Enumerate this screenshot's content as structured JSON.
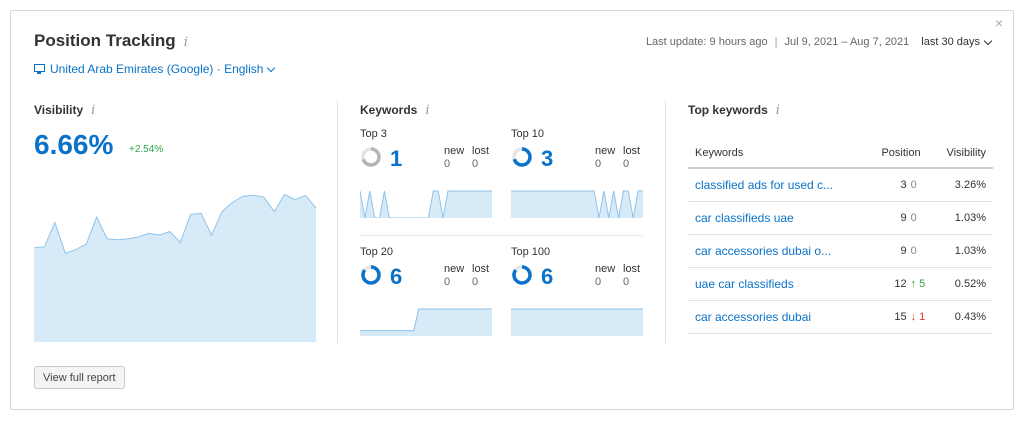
{
  "header": {
    "title": "Position Tracking",
    "info_glyph": "i",
    "last_update": "Last update: 9 hours ago",
    "separator": "|",
    "date_range": "Jul 9, 2021 – Aug 7, 2021",
    "period": "last 30 days",
    "close_glyph": "×",
    "location": "United Arab Emirates (Google) · English"
  },
  "visibility": {
    "label": "Visibility",
    "value": "6.66%",
    "change": "+2.54%",
    "chart_color": "#d6eaf8",
    "line_color": "#8fc3ea",
    "series": [
      5.2,
      5.25,
      6.6,
      4.9,
      5.1,
      5.4,
      6.9,
      5.7,
      5.65,
      5.7,
      5.8,
      6.0,
      5.9,
      6.1,
      5.5,
      7.05,
      7.1,
      5.9,
      7.2,
      7.7,
      8.05,
      8.1,
      8.0,
      7.2,
      8.15,
      7.85,
      8.1,
      7.4
    ],
    "ymin": 0,
    "ymax": 9
  },
  "keywords": {
    "label": "Keywords",
    "new_label": "new",
    "lost_label": "lost",
    "boxes": [
      {
        "label": "Top 3",
        "count": "1",
        "new": "0",
        "lost": "0",
        "fill": 0.7,
        "spark": [
          1,
          0,
          1,
          0,
          0,
          1,
          0,
          0,
          0,
          0,
          0,
          0,
          0,
          0,
          0,
          1,
          1,
          0,
          1,
          1,
          1,
          1,
          1,
          1,
          1,
          1,
          1,
          1
        ]
      },
      {
        "label": "Top 10",
        "count": "3",
        "new": "0",
        "lost": "0",
        "fill": 0.7,
        "spark": [
          1,
          1,
          1,
          1,
          1,
          1,
          1,
          1,
          1,
          1,
          1,
          1,
          1,
          1,
          1,
          1,
          1,
          1,
          0,
          1,
          0,
          1,
          0,
          1,
          1,
          0,
          1,
          1
        ]
      },
      {
        "label": "Top 20",
        "count": "6",
        "new": "0",
        "lost": "0",
        "fill": 0.85,
        "spark": [
          0.2,
          0.2,
          0.2,
          0.2,
          0.2,
          0.2,
          0.2,
          0.2,
          0.2,
          0.2,
          0.2,
          0.2,
          1,
          1,
          1,
          1,
          1,
          1,
          1,
          1,
          1,
          1,
          1,
          1,
          1,
          1,
          1,
          1
        ]
      },
      {
        "label": "Top 100",
        "count": "6",
        "new": "0",
        "lost": "0",
        "fill": 0.85,
        "spark": [
          1,
          1,
          1,
          1,
          1,
          1,
          1,
          1,
          1,
          1,
          1,
          1,
          1,
          1,
          1,
          1,
          1,
          1,
          1,
          1,
          1,
          1,
          1,
          1,
          1,
          1,
          1,
          1
        ]
      }
    ]
  },
  "top_keywords": {
    "label": "Top keywords",
    "columns": [
      "Keywords",
      "Position",
      "Visibility"
    ],
    "rows": [
      {
        "keyword": "classified ads for used c...",
        "position": "3",
        "diff": "0",
        "trend": "none",
        "visibility": "3.26%"
      },
      {
        "keyword": "car classifieds uae",
        "position": "9",
        "diff": "0",
        "trend": "none",
        "visibility": "1.03%"
      },
      {
        "keyword": "car accessories dubai o...",
        "position": "9",
        "diff": "0",
        "trend": "none",
        "visibility": "1.03%"
      },
      {
        "keyword": "uae car classifieds",
        "position": "12",
        "diff": "↑ 5",
        "trend": "up",
        "visibility": "0.52%"
      },
      {
        "keyword": "car accessories dubai",
        "position": "15",
        "diff": "↓ 1",
        "trend": "down",
        "visibility": "0.43%"
      }
    ]
  },
  "footer": {
    "view_full_report": "View full report"
  },
  "colors": {
    "accent": "#0a72c9",
    "positive": "#2fa64c",
    "negative": "#e0352b",
    "ring_grey": "#b5b5b5"
  }
}
